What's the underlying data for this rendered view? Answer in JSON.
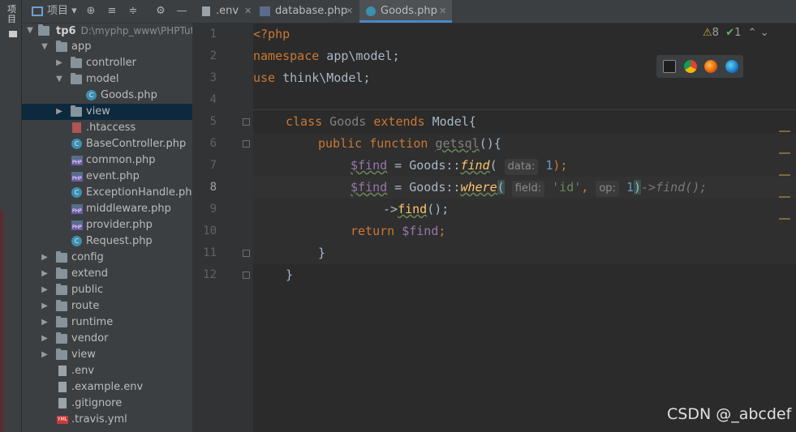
{
  "sidebar_tab": "项目",
  "project_panel": {
    "view_label": "项目",
    "root_name": "tp6",
    "root_path": "D:\\myphp_www\\PHPTutc",
    "tree": [
      {
        "label": "app"
      },
      {
        "label": "controller"
      },
      {
        "label": "model"
      },
      {
        "label": "Goods.php"
      },
      {
        "label": "view"
      },
      {
        "label": ".htaccess"
      },
      {
        "label": "BaseController.php"
      },
      {
        "label": "common.php"
      },
      {
        "label": "event.php"
      },
      {
        "label": "ExceptionHandle.php"
      },
      {
        "label": "middleware.php"
      },
      {
        "label": "provider.php"
      },
      {
        "label": "Request.php"
      },
      {
        "label": "config"
      },
      {
        "label": "extend"
      },
      {
        "label": "public"
      },
      {
        "label": "route"
      },
      {
        "label": "runtime"
      },
      {
        "label": "vendor"
      },
      {
        "label": "view"
      },
      {
        "label": ".env"
      },
      {
        "label": ".example.env"
      },
      {
        "label": ".gitignore"
      },
      {
        "label": ".travis.yml"
      }
    ]
  },
  "tabs": [
    {
      "label": ".env"
    },
    {
      "label": "database.php"
    },
    {
      "label": "Goods.php"
    }
  ],
  "editor": {
    "line_numbers": [
      "1",
      "2",
      "3",
      "4",
      "5",
      "6",
      "7",
      "8",
      "9",
      "10",
      "11",
      "12"
    ],
    "inspections": {
      "warnings": "8",
      "ok": "1"
    },
    "code": {
      "l1": "<?php",
      "l2_kw": "namespace",
      "l2_rest": " app\\model;",
      "l3_kw": "use",
      "l3_rest": " think\\Model;",
      "l5_kw1": "class",
      "l5_name": " Goods ",
      "l5_kw2": "extends",
      "l5_rest": " Model{",
      "l6_kw1": "public",
      "l6_kw2": " function ",
      "l6_fn": "getsql",
      "l6_rest": "(){",
      "l7_var": "$find",
      "l7_mid": " = Goods::",
      "l7_fn": "find",
      "l7_open": "(",
      "l7_hint": "data:",
      "l7_num": "1",
      "l7_close": ");",
      "l8_var": "$find",
      "l8_mid": " = Goods::",
      "l8_fn": "where",
      "l8_open": "(",
      "l8_hint1": "field:",
      "l8_str": "'id'",
      "l8_comma": ",",
      "l8_hint2": "op:",
      "l8_num": "1",
      "l8_close": ")",
      "l8_ghost": "->find();",
      "l9_arrow": "->",
      "l9_fn": "find",
      "l9_rest": "();",
      "l10_kw": "return",
      "l10_var": " $find",
      "l10_rest": ";",
      "l11": "}",
      "l12": "}"
    }
  },
  "watermark": "CSDN @_abcdef"
}
